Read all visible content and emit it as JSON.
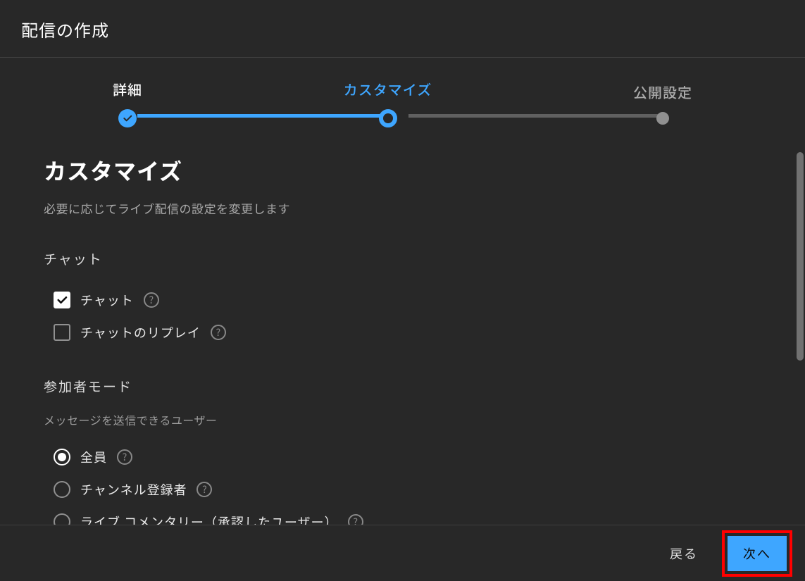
{
  "header": {
    "title": "配信の作成"
  },
  "stepper": {
    "steps": [
      {
        "label": "詳細",
        "state": "done"
      },
      {
        "label": "カスタマイズ",
        "state": "active"
      },
      {
        "label": "公開設定",
        "state": "future"
      }
    ]
  },
  "main": {
    "title": "カスタマイズ",
    "description": "必要に応じてライブ配信の設定を変更します",
    "chat": {
      "group_title": "チャット",
      "options": {
        "chat_label": "チャット",
        "replay_label": "チャットのリプレイ"
      }
    },
    "participant": {
      "group_title": "参加者モード",
      "group_desc": "メッセージを送信できるユーザー",
      "options": {
        "everyone": "全員",
        "subscribers": "チャンネル登録者",
        "live_commentary": "ライブ コメンタリー（承認したユーザー）"
      }
    }
  },
  "footer": {
    "back": "戻る",
    "next": "次へ"
  }
}
